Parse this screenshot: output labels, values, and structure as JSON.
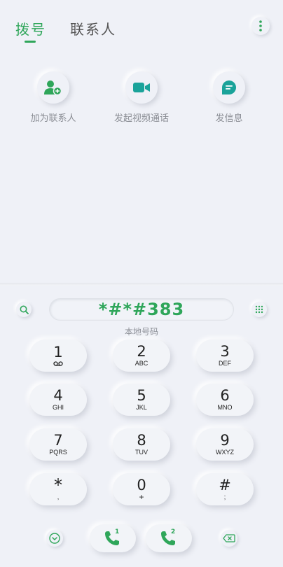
{
  "tabs": [
    {
      "label": "拨号",
      "active": true
    },
    {
      "label": "联系人",
      "active": false
    }
  ],
  "actions": [
    {
      "label": "加为联系人",
      "icon": "add-contact-icon"
    },
    {
      "label": "发起视频通话",
      "icon": "video-call-icon"
    },
    {
      "label": "发信息",
      "icon": "message-icon"
    }
  ],
  "dialer": {
    "number": "*#*#383",
    "location": "本地号码"
  },
  "keys": [
    {
      "digit": "1",
      "letters": "voicemail"
    },
    {
      "digit": "2",
      "letters": "ABC"
    },
    {
      "digit": "3",
      "letters": "DEF"
    },
    {
      "digit": "4",
      "letters": "GHI"
    },
    {
      "digit": "5",
      "letters": "JKL"
    },
    {
      "digit": "6",
      "letters": "MNO"
    },
    {
      "digit": "7",
      "letters": "PQRS"
    },
    {
      "digit": "8",
      "letters": "TUV"
    },
    {
      "digit": "9",
      "letters": "WXYZ"
    },
    {
      "digit": "*",
      "letters": ","
    },
    {
      "digit": "0",
      "letters": "+"
    },
    {
      "digit": "#",
      "letters": ";"
    }
  ],
  "colors": {
    "accent": "#2fa65a",
    "teal": "#1aa39a",
    "background": "#eff1f7"
  },
  "sim_labels": [
    "1",
    "2"
  ]
}
